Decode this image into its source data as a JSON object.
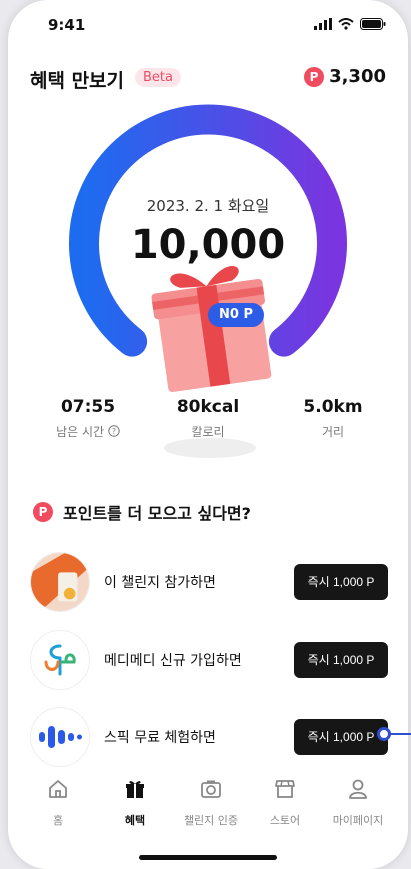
{
  "status_bar": {
    "time": "9:41"
  },
  "header": {
    "title": "혜택 만보기",
    "badge": "Beta",
    "points": "3,300",
    "coin_letter": "P"
  },
  "pedometer": {
    "date": "2023. 2. 1 화요일",
    "steps": "10,000",
    "steps_progress": 1.0,
    "gift_points_badge": "N0 P"
  },
  "stats": [
    {
      "value": "07:55",
      "label": "남은 시간"
    },
    {
      "value": "80kcal",
      "label": "칼로리"
    },
    {
      "value": "5.0km",
      "label": "거리"
    }
  ],
  "section": {
    "title": "포인트를 더 모으고 싶다면?",
    "coin_letter": "P"
  },
  "offers": [
    {
      "label": "이 챌린지 참가하면",
      "button": "즉시 1,000 P",
      "thumb": "challenge-photo"
    },
    {
      "label": "메디메디 신규 가입하면",
      "button": "즉시 1,000 P",
      "thumb": "medimedi-logo-icon"
    },
    {
      "label": "스픽 무료 체험하면",
      "button": "즉시 1,000 P",
      "thumb": "speak-logo-icon"
    }
  ],
  "tabs": [
    {
      "label": "홈",
      "icon": "home-icon",
      "active": false
    },
    {
      "label": "혜택",
      "icon": "gift-icon",
      "active": true
    },
    {
      "label": "챌린지 인증",
      "icon": "camera-icon",
      "active": false
    },
    {
      "label": "스토어",
      "icon": "store-icon",
      "active": false
    },
    {
      "label": "마이페이지",
      "icon": "user-icon",
      "active": false
    }
  ],
  "colors": {
    "arc_start": "#2563eb",
    "arc_end": "#7c3aed",
    "accent_red": "#f04b5e",
    "button_dark": "#161616"
  }
}
